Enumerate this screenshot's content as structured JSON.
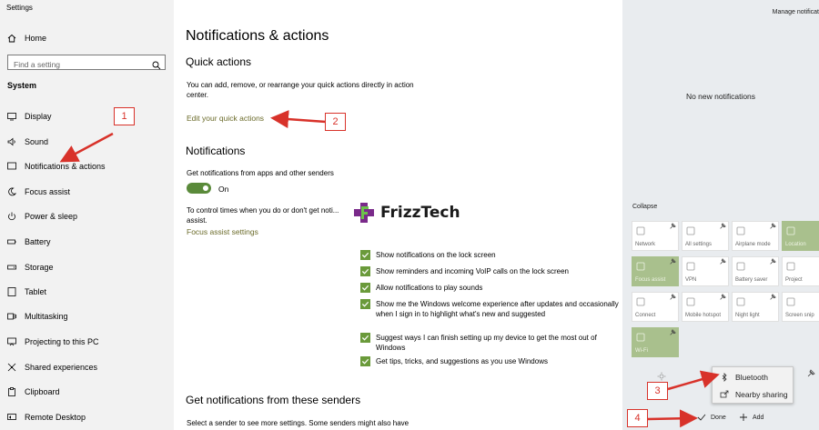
{
  "app_title": "Settings",
  "sidebar": {
    "home_label": "Home",
    "search_placeholder": "Find a setting",
    "section_label": "System",
    "items": [
      {
        "label": "Display",
        "icon": "display-icon"
      },
      {
        "label": "Sound",
        "icon": "sound-icon"
      },
      {
        "label": "Notifications & actions",
        "icon": "notifications-icon"
      },
      {
        "label": "Focus assist",
        "icon": "focus-assist-icon"
      },
      {
        "label": "Power & sleep",
        "icon": "power-icon"
      },
      {
        "label": "Battery",
        "icon": "battery-icon"
      },
      {
        "label": "Storage",
        "icon": "storage-icon"
      },
      {
        "label": "Tablet",
        "icon": "tablet-icon"
      },
      {
        "label": "Multitasking",
        "icon": "multitasking-icon"
      },
      {
        "label": "Projecting to this PC",
        "icon": "projecting-icon"
      },
      {
        "label": "Shared experiences",
        "icon": "shared-experiences-icon"
      },
      {
        "label": "Clipboard",
        "icon": "clipboard-icon"
      },
      {
        "label": "Remote Desktop",
        "icon": "remote-desktop-icon"
      }
    ]
  },
  "main": {
    "title": "Notifications & actions",
    "quick_actions_heading": "Quick actions",
    "quick_actions_desc": "You can add, remove, or rearrange your quick actions directly in action center.",
    "edit_link": "Edit your quick actions",
    "notifications_heading": "Notifications",
    "get_notifications_label": "Get notifications from apps and other senders",
    "toggle_state": "On",
    "focus_text": "To control times when you do or don't get noti... assist.",
    "focus_link": "Focus assist settings",
    "checkboxes": [
      "Show notifications on the lock screen",
      "Show reminders and incoming VoIP calls on the lock screen",
      "Allow notifications to play sounds",
      "Show me the Windows welcome experience after updates and occasionally when I sign in to highlight what's new and suggested",
      "Suggest ways I can finish setting up my device to get the most out of Windows",
      "Get tips, tricks, and suggestions as you use Windows"
    ],
    "senders_heading": "Get notifications from these senders",
    "senders_desc": "Select a sender to see more settings. Some senders might also have"
  },
  "logo_text": "FrizzTech",
  "action_center": {
    "manage_label": "Manage notificat",
    "no_notifications": "No new notifications",
    "collapse_label": "Collapse",
    "tiles": [
      {
        "label": "Network",
        "on": false
      },
      {
        "label": "All settings",
        "on": false
      },
      {
        "label": "Airplane mode",
        "on": false
      },
      {
        "label": "Location",
        "on": true
      },
      {
        "label": "Focus assist",
        "on": true
      },
      {
        "label": "VPN",
        "on": false
      },
      {
        "label": "Battery saver",
        "on": false
      },
      {
        "label": "Project",
        "on": false
      },
      {
        "label": "Connect",
        "on": false
      },
      {
        "label": "Mobile hotspot",
        "on": false
      },
      {
        "label": "Night light",
        "on": false
      },
      {
        "label": "Screen snip",
        "on": false
      },
      {
        "label": "Wi-Fi",
        "on": true
      }
    ],
    "popup_items": [
      "Bluetooth",
      "Nearby sharing"
    ],
    "done_label": "Done",
    "add_label": "Add"
  },
  "annotations": [
    "1",
    "2",
    "3",
    "4"
  ],
  "colors": {
    "accent_green": "#6a9a3a",
    "tile_on": "#a9c08d",
    "annotation_red": "#d8322a",
    "link": "#6b6b2a"
  }
}
